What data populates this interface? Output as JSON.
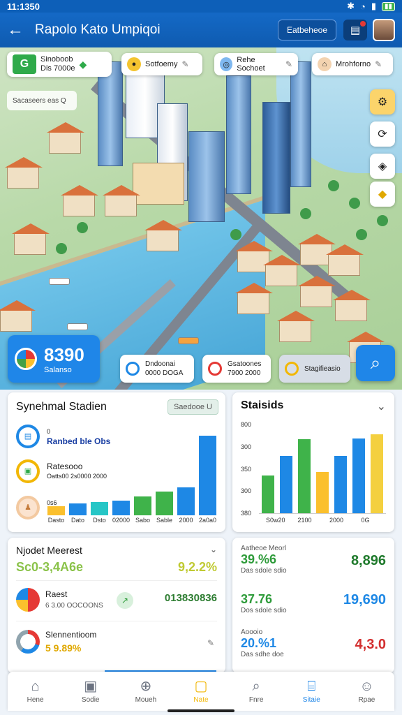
{
  "status": {
    "time": "11:1350"
  },
  "appbar": {
    "title": "Rapolo Kato Umpiqoi",
    "pill": "Eatbeheoe"
  },
  "map": {
    "green_chip": {
      "icon": "G",
      "line1": "Sinoboob",
      "line2": "Dis 7000e"
    },
    "chips": [
      "Sotfoemy",
      "Rehe Sochoet",
      "Mrohforno"
    ],
    "search_tag": "Sacaseers eas Q",
    "score_value": "8390",
    "score_label": "Salanso",
    "mini_cards": [
      {
        "line1": "Dndoonai",
        "line2": "0000 DOGA"
      },
      {
        "line1": "Gsatoones",
        "line2": "7900 2000"
      },
      {
        "line1": "Stagifieasio",
        "line2": ""
      }
    ]
  },
  "synth": {
    "title": "Synehmal Stadien",
    "filter": "Saedooe U",
    "items": [
      {
        "t1": "Ranbed ble Obs",
        "t2": "0"
      },
      {
        "t1": "Ratesooo",
        "t2": "Oatts00 2s0000 2000"
      },
      {
        "t1": "0s6",
        "t2": ""
      }
    ]
  },
  "chart_data": [
    {
      "type": "bar",
      "title": "Synehmal Stadien",
      "categories": [
        "Dasto",
        "Dato",
        "Dsto",
        "02000",
        "Sabo",
        "Sable",
        "2000",
        "2a0a0"
      ],
      "values": [
        14,
        18,
        20,
        22,
        28,
        36,
        42,
        120
      ],
      "colors": [
        "#fbc02d",
        "#1e88e5",
        "#26c6c6",
        "#1e88e5",
        "#3fb34a",
        "#3fb34a",
        "#1e88e5",
        "#1e88e5"
      ],
      "ylim": [
        0,
        130
      ]
    },
    {
      "type": "bar",
      "title": "Staisids",
      "categories": [
        "",
        "",
        "",
        "",
        "",
        "",
        ""
      ],
      "x_tick_labels": [
        "S0w20",
        "2100",
        "2000",
        "0G"
      ],
      "values": [
        180,
        270,
        350,
        195,
        270,
        355,
        375
      ],
      "colors": [
        "#3fb34a",
        "#1e88e5",
        "#3fb34a",
        "#fbc02d",
        "#1e88e5",
        "#1e88e5",
        "#f4d03f"
      ],
      "y_tick_labels": [
        "800",
        "300",
        "350",
        "300",
        "380"
      ],
      "ylim": [
        0,
        420
      ]
    }
  ],
  "market": {
    "title": "Njodet Meerest",
    "row1_left": "Sc0-3,4A6e",
    "row1_right": "9,2.2%",
    "row2_label": "Raest",
    "row2_sub": "6 3.00 OOCOONS",
    "row2_right": "013830836",
    "row3_label": "Slennentioom",
    "row3_value": "5 9.89%"
  },
  "metrics": [
    {
      "label": "Aatheoe Meorl",
      "v1": "39.%6",
      "sub": "Das sdole sdio",
      "v2": "8,896",
      "c1": "#2e9b3a",
      "c2": "#1f7a2c"
    },
    {
      "label": "",
      "v1": "37.76",
      "sub": "Dos sdole sdio",
      "v2": "19,690",
      "c1": "#2e9b3a",
      "c2": "#1e88e5"
    },
    {
      "label": "Aoooio",
      "v1": "20.%1",
      "sub": "Das sdhe doe",
      "v2": "4,3.0",
      "c1": "#1e88e5",
      "c2": "#d32f2f"
    }
  ],
  "nav": [
    {
      "label": "Hene",
      "glyph": "⌂",
      "icon": "home-icon"
    },
    {
      "label": "Sodie",
      "glyph": "▣",
      "icon": "photo-icon"
    },
    {
      "label": "Moueh",
      "glyph": "⊕",
      "icon": "compass-icon"
    },
    {
      "label": "Nate",
      "glyph": "▢",
      "icon": "wallet-icon"
    },
    {
      "label": "Fnre",
      "glyph": "⌕",
      "icon": "search-icon"
    },
    {
      "label": "Sitaie",
      "glyph": "⌸",
      "icon": "store-icon"
    },
    {
      "label": "Rpae",
      "glyph": "☺",
      "icon": "profile-icon"
    }
  ]
}
